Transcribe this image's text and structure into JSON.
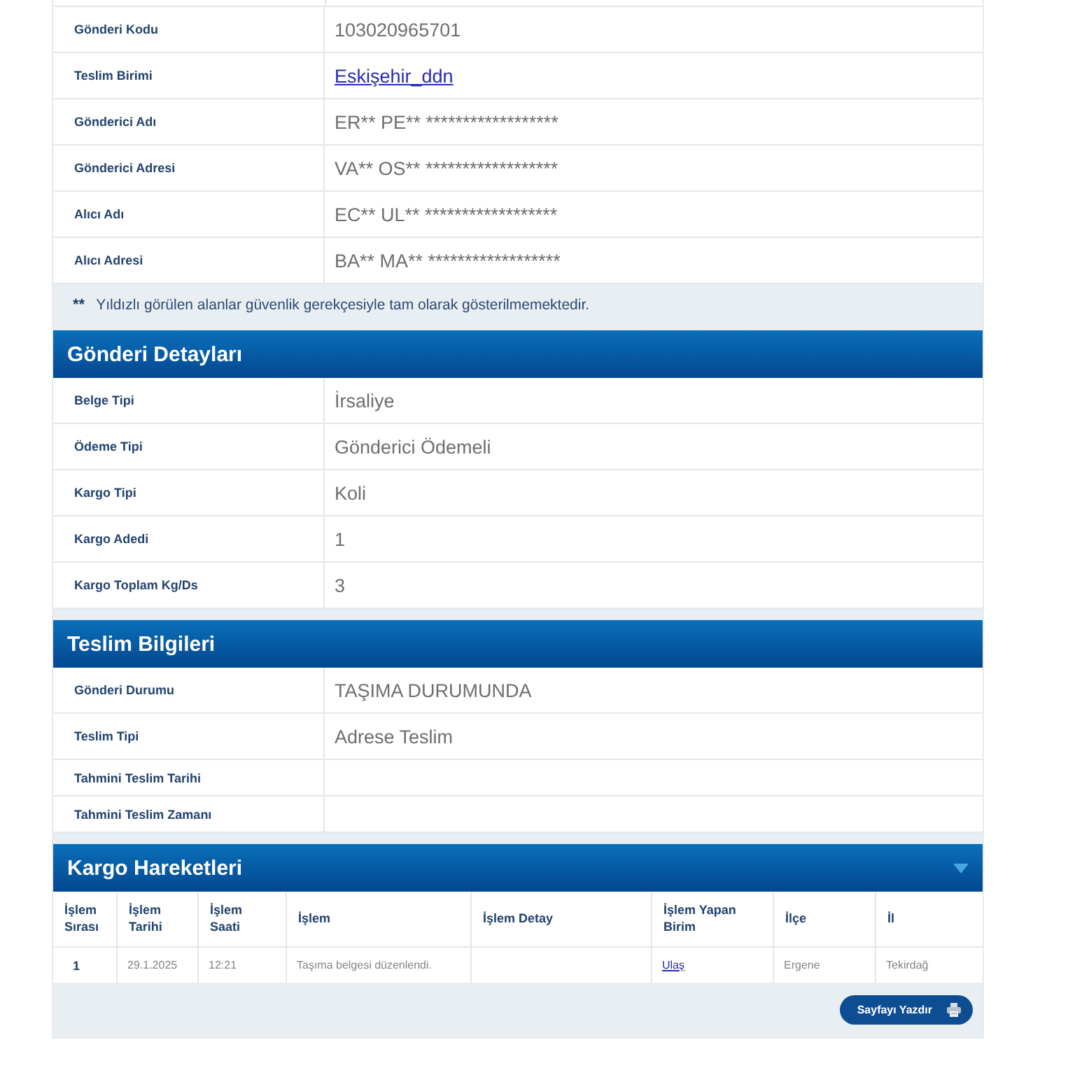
{
  "shipment_info": {
    "rows": [
      {
        "kind": "text",
        "label": "Gönderi Kodu",
        "value": "103020965701"
      },
      {
        "kind": "link",
        "label": "Teslim Birimi",
        "value": "Eskişehir_ddn"
      },
      {
        "kind": "text",
        "label": "Gönderici Adı",
        "value": "ER** PE** ******************"
      },
      {
        "kind": "text",
        "label": "Gönderici Adresi",
        "value": "VA** OS** ******************"
      },
      {
        "kind": "text",
        "label": "Alıcı Adı",
        "value": "EC** UL** ******************"
      },
      {
        "kind": "text",
        "label": "Alıcı Adresi",
        "value": "BA** MA** ******************"
      }
    ],
    "note": {
      "mark": "**",
      "text": "Yıldızlı görülen alanlar güvenlik gerekçesiyle tam olarak gösterilmemektedir."
    }
  },
  "sections": [
    {
      "kind": "fields",
      "title": "Gönderi Detayları",
      "rows": [
        {
          "kind": "text",
          "label": "Belge Tipi",
          "value": "İrsaliye"
        },
        {
          "kind": "text",
          "label": "Ödeme Tipi",
          "value": "Gönderici Ödemeli"
        },
        {
          "kind": "text",
          "label": "Kargo Tipi",
          "value": "Koli"
        },
        {
          "kind": "text",
          "label": "Kargo Adedi",
          "value": "1"
        },
        {
          "kind": "text",
          "label": "Kargo Toplam Kg/Ds",
          "value": "3"
        }
      ]
    },
    {
      "kind": "fields",
      "title": "Teslim Bilgileri",
      "rows": [
        {
          "kind": "text",
          "label": "Gönderi Durumu",
          "value": "TAŞIMA DURUMUNDA"
        },
        {
          "kind": "text",
          "label": "Teslim Tipi",
          "value": "Adrese Teslim"
        },
        {
          "kind": "empty",
          "label": "Tahmini Teslim Tarihi"
        },
        {
          "kind": "empty",
          "label": "Tahmini Teslim Zamanı"
        }
      ]
    },
    {
      "kind": "movements",
      "title": "Kargo Hareketleri",
      "columns": [
        "İşlem Sırası",
        "İşlem Tarihi",
        "İşlem Saati",
        "İşlem",
        "İşlem Detay",
        "İşlem Yapan Birim",
        "İlçe",
        "İl"
      ],
      "rows": [
        [
          {
            "kind": "index",
            "text": "1"
          },
          {
            "kind": "text",
            "text": "29.1.2025"
          },
          {
            "kind": "text",
            "text": "12:21"
          },
          {
            "kind": "text",
            "text": "Taşıma belgesi düzenlendi."
          },
          {
            "kind": "empty"
          },
          {
            "kind": "link",
            "text": "Ulaş"
          },
          {
            "kind": "text",
            "text": "Ergene"
          },
          {
            "kind": "text",
            "text": "Tekirdağ"
          }
        ]
      ]
    }
  ],
  "print_button": {
    "label": "Sayfayı Yazdır"
  }
}
